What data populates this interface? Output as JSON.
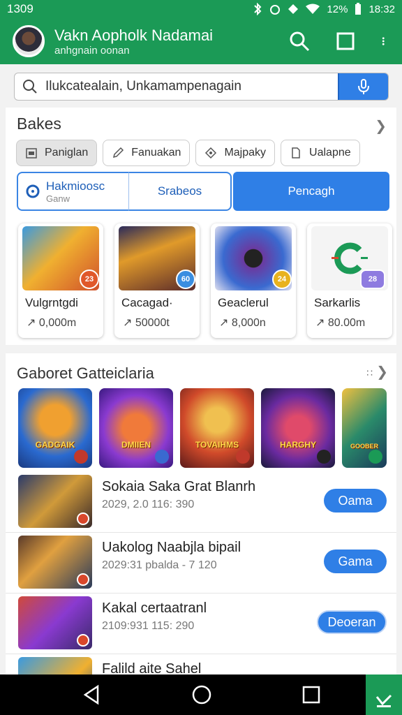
{
  "status_bar": {
    "time_left": "1309",
    "battery": "12%",
    "time_right": "18:32"
  },
  "app_bar": {
    "title": "Vakn Aopholk Nadamai",
    "subtitle": "anhgnain oonan"
  },
  "search": {
    "placeholder": "Ilukcatealain, Unkamampenagain"
  },
  "section1": {
    "title": "Bakes",
    "chips": [
      "Paniglan",
      "Fanuakan",
      "Majpaky",
      "Ualapne"
    ],
    "segments": {
      "a_title": "Hakmioosc",
      "a_sub": "Ganw",
      "b": "Srabeos",
      "c": "Pencagh"
    },
    "apps": [
      {
        "name": "Vulgrntgdi",
        "price": "0,000m",
        "badge": "23",
        "badge_color": "#e0582a"
      },
      {
        "name": "Cacagad·",
        "price": "50000t",
        "badge": "60",
        "badge_color": "#3a8de0"
      },
      {
        "name": "Geaclerul",
        "price": "8,000n",
        "badge": "24",
        "badge_color": "#e8b21f"
      },
      {
        "name": "Sarkarlis",
        "price": "80.00m",
        "badge": "28",
        "badge_color": "#8e7be0"
      }
    ]
  },
  "section2": {
    "title": "Gaboret Gatteiclaria",
    "banners": [
      {
        "label": "GADGAIK"
      },
      {
        "label": "DMIIEN"
      },
      {
        "label": "TOVAIHMS"
      },
      {
        "label": "HARGHY"
      },
      {
        "label": "GOOBER"
      }
    ],
    "items": [
      {
        "title": "Sokaia Saka Grat Blanrh",
        "meta": "2029, 2.0  116: 390",
        "button": "Oama"
      },
      {
        "title": "Uakolog Naabjla bipail",
        "meta": "2029:31  pbalda - 7  120",
        "button": "Gama"
      },
      {
        "title": "Kakal certaatranl",
        "meta": "2109:931  115: 290",
        "button": "Deoeran"
      },
      {
        "title": "Falild  aite Sahel",
        "meta": "",
        "button": ""
      }
    ]
  },
  "colors": {
    "primary_green": "#1b9a56",
    "accent_blue": "#2f7fe6"
  }
}
